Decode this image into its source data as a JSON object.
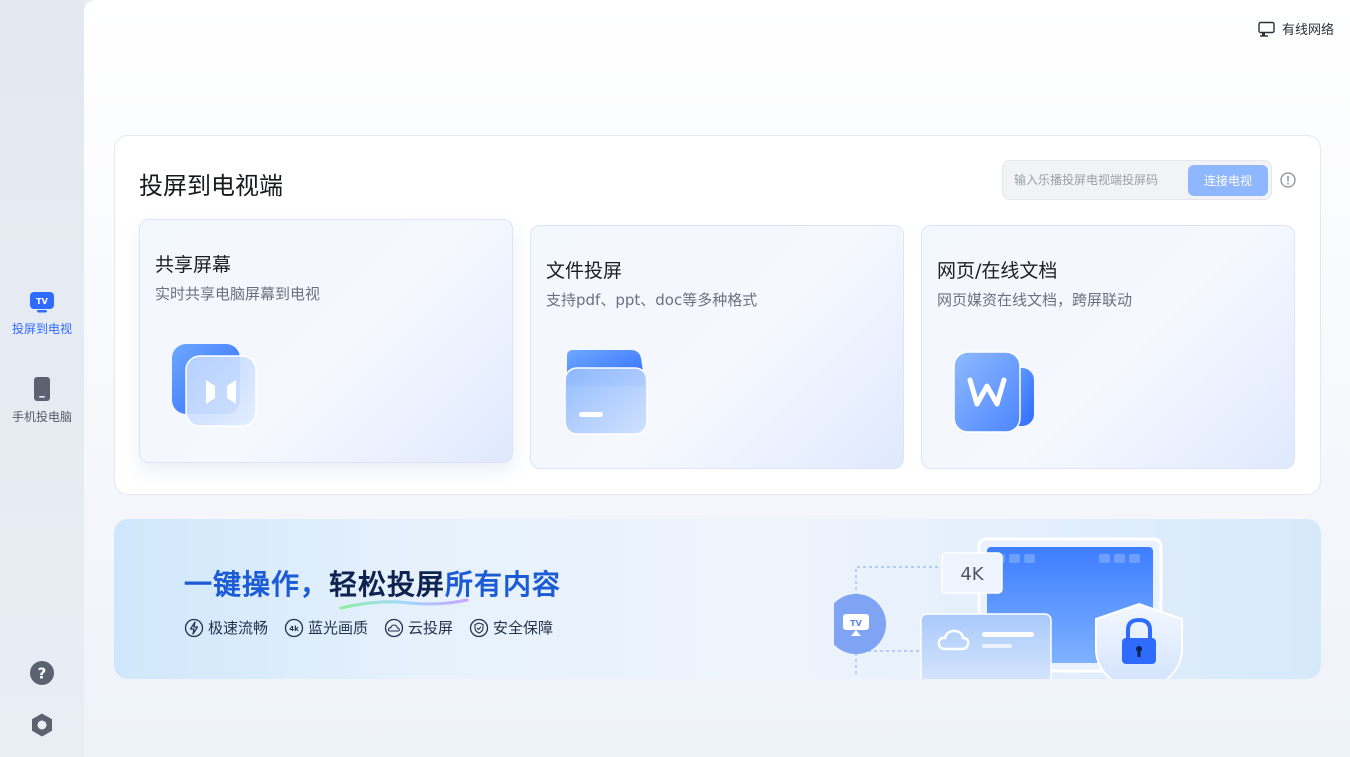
{
  "sidebar": {
    "items": [
      {
        "label": "投屏到电视",
        "icon": "tv-icon",
        "active": true
      },
      {
        "label": "手机投电脑",
        "icon": "phone-icon",
        "active": false
      }
    ],
    "help_icon": "help-icon",
    "settings_icon": "settings-icon"
  },
  "header": {
    "network_label": "有线网络",
    "network_icon": "wired-network-icon"
  },
  "panel": {
    "title": "投屏到电视端",
    "code_placeholder": "输入乐播投屏电视端投屏码",
    "connect_label": "连接电视",
    "info_icon": "info-icon"
  },
  "cards": [
    {
      "title": "共享屏幕",
      "desc": "实时共享电脑屏幕到电视",
      "icon": "share-screen-icon"
    },
    {
      "title": "文件投屏",
      "desc": "支持pdf、ppt、doc等多种格式",
      "icon": "folder-icon"
    },
    {
      "title": "网页/在线文档",
      "desc": "网页媒资在线文档，跨屏联动",
      "icon": "web-doc-icon"
    }
  ],
  "banner": {
    "headline_part1": "一键操作，",
    "headline_part2": "轻松投屏",
    "headline_part3": "所有内容",
    "features": [
      {
        "label": "极速流畅",
        "icon": "lightning-icon"
      },
      {
        "label": "蓝光画质",
        "icon": "4k-icon"
      },
      {
        "label": "云投屏",
        "icon": "cloud-icon"
      },
      {
        "label": "安全保障",
        "icon": "shield-icon"
      }
    ],
    "art_4k_label": "4K",
    "art_tv_label": "TV"
  },
  "colors": {
    "accent": "#2f6bff",
    "connect_button": "#8fb7ff",
    "headline_blue": "#1c5bd6",
    "headline_dark": "#0f2350"
  }
}
